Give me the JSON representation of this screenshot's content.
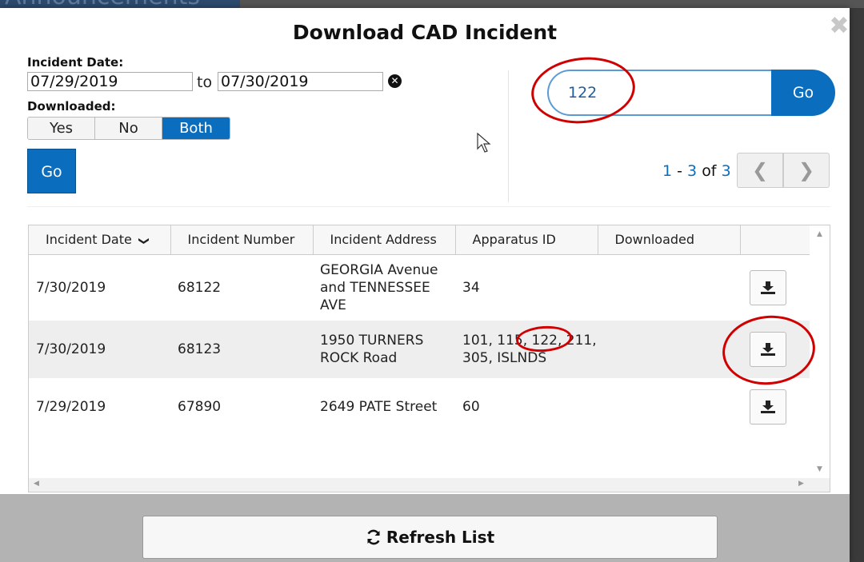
{
  "background": {
    "heading": "Announcements"
  },
  "modal": {
    "title": "Download CAD Incident",
    "close_symbol": "✖"
  },
  "filters": {
    "incident_date_label": "Incident Date:",
    "from_date": "07/29/2019",
    "to_label": "to",
    "to_date": "07/30/2019",
    "clear_symbol": "✕",
    "downloaded_label": "Downloaded:",
    "downloaded_options": [
      "Yes",
      "No",
      "Both"
    ],
    "downloaded_selected": "Both",
    "go_label": "Go"
  },
  "search": {
    "value": "122",
    "go_label": "Go"
  },
  "pager": {
    "start": "1",
    "dash": "-",
    "end": "3",
    "of": "of",
    "total": "3",
    "prev_symbol": "❮",
    "next_symbol": "❯"
  },
  "table": {
    "columns": [
      "Incident Date",
      "Incident Number",
      "Incident Address",
      "Apparatus ID",
      "Downloaded",
      ""
    ],
    "sort_indicator": "❯",
    "rows": [
      {
        "date": "7/30/2019",
        "number": "68122",
        "address": "GEORGIA Avenue and TENNESSEE AVE",
        "apparatus": "34",
        "downloaded": ""
      },
      {
        "date": "7/30/2019",
        "number": "68123",
        "address": "1950 TURNERS ROCK Road",
        "apparatus": "101, 115, 122, 211, 305, ISLNDS",
        "downloaded": ""
      },
      {
        "date": "7/29/2019",
        "number": "67890",
        "address": "2649 PATE Street",
        "apparatus": "60",
        "downloaded": ""
      }
    ],
    "download_icon": "download-icon"
  },
  "footer": {
    "refresh_label": "Refresh List",
    "refresh_icon": "refresh-icon"
  },
  "colors": {
    "accent": "#0b6dbd",
    "annotation": "#d00000",
    "footer": "#b3b3b3"
  }
}
